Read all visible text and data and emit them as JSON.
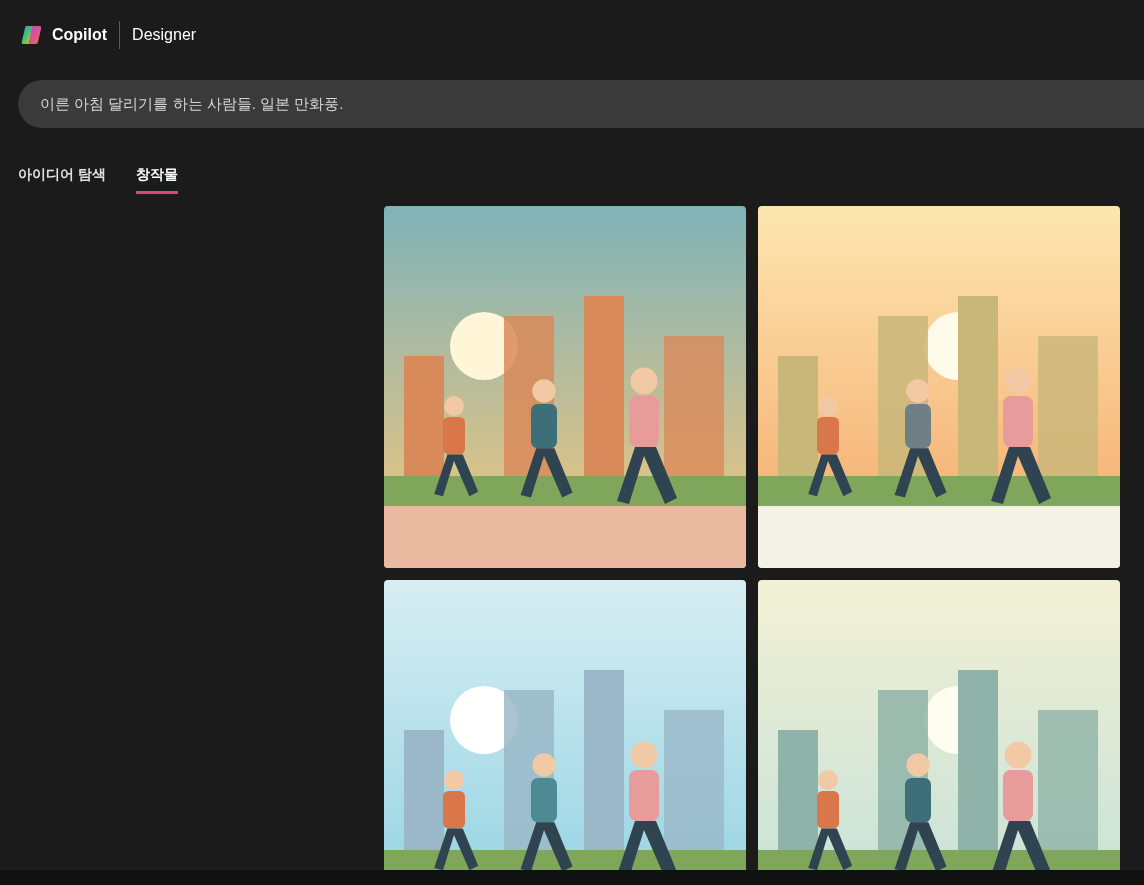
{
  "header": {
    "brand": "Copilot",
    "product": "Designer"
  },
  "prompt": {
    "value": "이른 아침 달리기를 하는 사람들. 일본 만화풍."
  },
  "tabs": [
    {
      "label": "아이디어 탐색",
      "selected": false
    },
    {
      "label": "창작물",
      "selected": true
    }
  ]
}
